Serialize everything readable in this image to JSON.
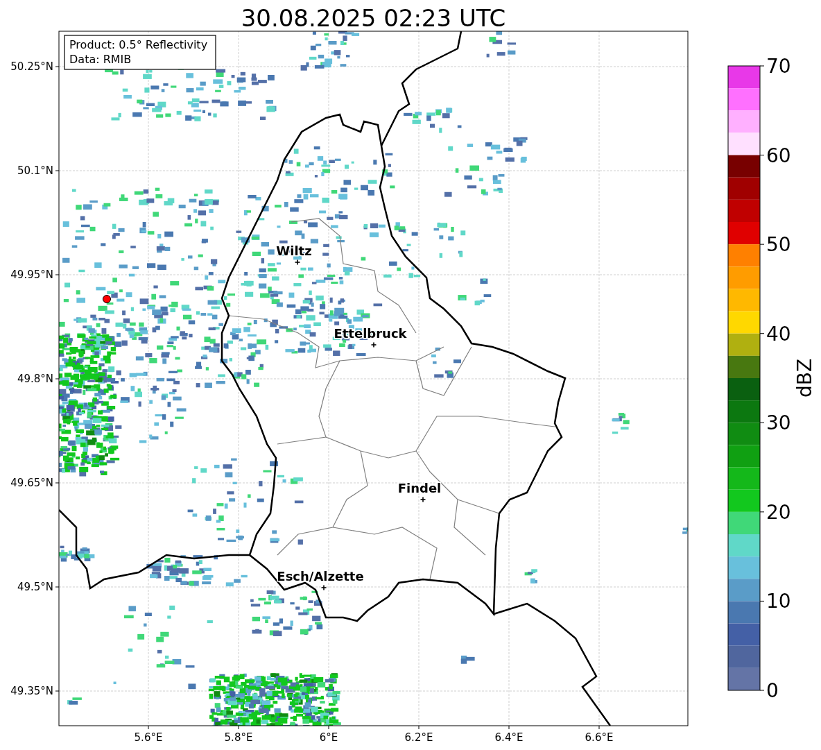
{
  "figure": {
    "title": "30.08.2025 02:23 UTC",
    "legend": [
      "Product: 0.5° Reflectivity",
      "Data: RMIB"
    ],
    "map": {
      "x_ticks": [
        "5.6°E",
        "5.8°E",
        "6°E",
        "6.2°E",
        "6.4°E",
        "6.6°E"
      ],
      "y_ticks": [
        "50.25°N",
        "50.1°N",
        "49.95°N",
        "49.8°N",
        "49.65°N",
        "49.5°N",
        "49.35°N"
      ],
      "cities": [
        {
          "name": "Wiltz"
        },
        {
          "name": "Ettelbruck"
        },
        {
          "name": "Findel"
        },
        {
          "name": "Esch/Alzette"
        }
      ]
    },
    "colorbar": {
      "label": "dBZ",
      "ticks": [
        "70",
        "60",
        "50",
        "40",
        "30",
        "20",
        "10",
        "0"
      ],
      "bands": [
        {
          "color": "#e838e8"
        },
        {
          "color": "#ff70ff"
        },
        {
          "color": "#ffb0ff"
        },
        {
          "color": "#ffe0ff"
        },
        {
          "color": "#780000"
        },
        {
          "color": "#a00000"
        },
        {
          "color": "#c00000"
        },
        {
          "color": "#e00000"
        },
        {
          "color": "#ff8000"
        },
        {
          "color": "#ff9c00"
        },
        {
          "color": "#ffb800"
        },
        {
          "color": "#ffd800"
        },
        {
          "color": "#b0b010"
        },
        {
          "color": "#487810"
        },
        {
          "color": "#0a6010"
        },
        {
          "color": "#0c7810"
        },
        {
          "color": "#108c12"
        },
        {
          "color": "#10a012"
        },
        {
          "color": "#14b81a"
        },
        {
          "color": "#12c81e"
        },
        {
          "color": "#40d878"
        },
        {
          "color": "#60d8c8"
        },
        {
          "color": "#68c0dc"
        },
        {
          "color": "#5a9cc8"
        },
        {
          "color": "#4a78b0"
        },
        {
          "color": "#4460a6"
        },
        {
          "color": "#50669e"
        },
        {
          "color": "#6474a6"
        }
      ]
    }
  }
}
